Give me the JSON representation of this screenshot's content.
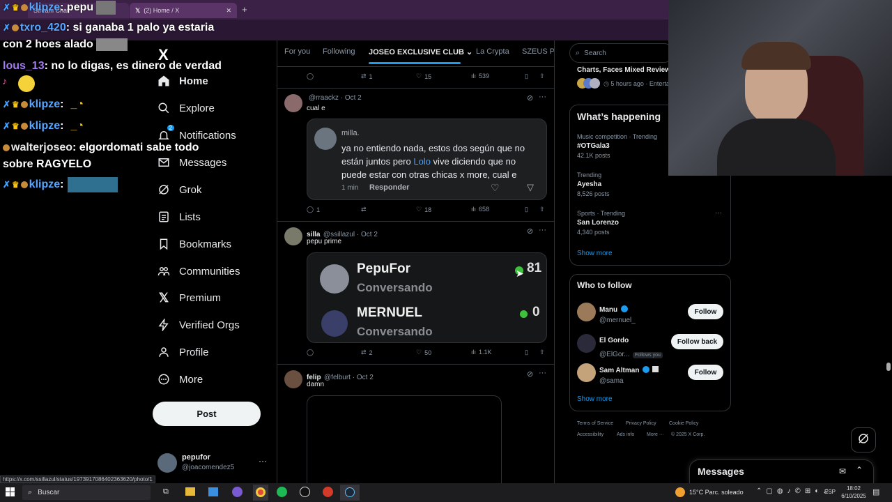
{
  "browser": {
    "tabs": [
      {
        "label": "Stream Chat"
      },
      {
        "label": "(2) Home / X"
      }
    ],
    "status_url": "https://x.com/ssillazul/status/1973917086402363620/photo/1"
  },
  "chat": [
    {
      "user": "klipze",
      "msg": ": pepu"
    },
    {
      "user": "txro_420",
      "msg": ": si ganaba 1 palo ya estaria"
    },
    {
      "user": "",
      "msg": "con 2 hoes alado"
    },
    {
      "user": "lous_13",
      "msg": ": no lo digas, es dinero de verdad"
    },
    {
      "user": "klipze",
      "msg": ":"
    },
    {
      "user": "klipze",
      "msg": ":"
    },
    {
      "user": "walterjoseo",
      "msg": ": elgordomati sabe todo"
    },
    {
      "user": "",
      "msg": "sobre RAGYELO"
    },
    {
      "user": "klipze",
      "msg": ":"
    }
  ],
  "nav": {
    "logo": "X",
    "items": [
      {
        "label": "Home",
        "icon": "home-icon"
      },
      {
        "label": "Explore",
        "icon": "search-icon"
      },
      {
        "label": "Notifications",
        "icon": "bell-icon",
        "badge": "2"
      },
      {
        "label": "Messages",
        "icon": "mail-icon"
      },
      {
        "label": "Grok",
        "icon": "grok-icon"
      },
      {
        "label": "Lists",
        "icon": "list-icon"
      },
      {
        "label": "Bookmarks",
        "icon": "bookmark-icon"
      },
      {
        "label": "Communities",
        "icon": "people-icon"
      },
      {
        "label": "Premium",
        "icon": "x-icon"
      },
      {
        "label": "Verified Orgs",
        "icon": "lightning-icon"
      },
      {
        "label": "Profile",
        "icon": "person-icon"
      },
      {
        "label": "More",
        "icon": "more-circle-icon"
      }
    ],
    "post_label": "Post",
    "account": {
      "name": "pepufor",
      "handle": "@joacomendez5"
    }
  },
  "timeline": {
    "tabs": [
      "For you",
      "Following",
      "JOSEO EXCLUSIVE CLUB",
      "La Crypta",
      "SZEUS Pe"
    ],
    "top_actions": {
      "replies": "",
      "reposts": "1",
      "likes": "15",
      "views": "539"
    },
    "posts": [
      {
        "handle": "@rraackz",
        "date": "Oct 2",
        "text": "cual e",
        "quote": {
          "name": "milla.",
          "text_a": "ya no entiendo nada, estos dos según que no están juntos pero ",
          "mention": "Lolo",
          "text_b": " vive diciendo que no puede estar con otras chicas x more, cual e",
          "time": "1 min",
          "reply": "Responder"
        },
        "actions": {
          "replies": "1",
          "reposts": "",
          "likes": "18",
          "views": "658"
        }
      },
      {
        "name": "silla",
        "handle": "@ssillazul",
        "date": "Oct 2",
        "text": "pepu prime",
        "card": [
          {
            "name": "PepuFor",
            "status": "Conversando",
            "count": "81"
          },
          {
            "name": "MERNUEL",
            "status": "Conversando",
            "count": "0"
          }
        ],
        "actions": {
          "replies": "",
          "reposts": "2",
          "likes": "50",
          "views": "1.1K"
        }
      },
      {
        "name": "felip",
        "handle": "@felburt",
        "date": "Oct 2",
        "text": "damn"
      }
    ]
  },
  "sidebar": {
    "search_placeholder": "Search",
    "news": {
      "title": "Charts, Faces Mixed Review",
      "meta": "5 hours ago · Entertainm"
    },
    "happening": {
      "title": "What’s happening",
      "trends": [
        {
          "meta": "Music competition · Trending",
          "name": "#OTGala3",
          "count": "42.1K posts"
        },
        {
          "meta": "Trending",
          "name": "Ayesha",
          "count": "8,526 posts"
        },
        {
          "meta": "Sports · Trending",
          "name": "San Lorenzo",
          "count": "4,340 posts"
        }
      ],
      "show_more": "Show more"
    },
    "who": {
      "title": "Who to follow",
      "people": [
        {
          "name": "Manu",
          "handle": "@mernuel_",
          "button": "Follow"
        },
        {
          "name": "El Gordo",
          "handle": "@ElGor...",
          "tag": "Follows you",
          "button": "Follow back"
        },
        {
          "name": "Sam Altman",
          "handle": "@sama",
          "button": "Follow"
        }
      ],
      "show_more": "Show more"
    },
    "footer": [
      "Terms of Service",
      "Privacy Policy",
      "Cookie Policy",
      "Accessibility",
      "Ads info",
      "More ···",
      "© 2025 X Corp."
    ],
    "messages_label": "Messages"
  },
  "taskbar": {
    "search": "Buscar",
    "weather": "15°C  Parc. soleado",
    "lang": "ESP",
    "time": "18:02",
    "date": "6/10/2025"
  }
}
